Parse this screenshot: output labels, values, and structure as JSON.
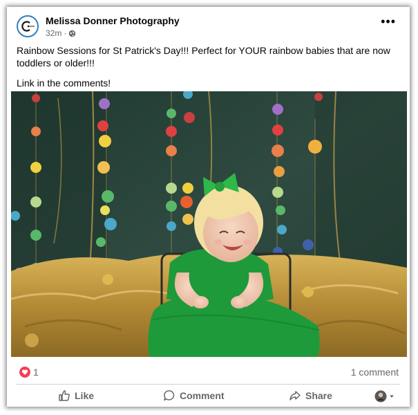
{
  "post": {
    "author": "Melissa Donner Photography",
    "timestamp": "32m",
    "privacy_icon": "globe-icon",
    "more_icon": "ellipsis-icon",
    "text_line1": "Rainbow Sessions for St Patrick's Day!!! Perfect for YOUR rainbow babies that are now toddlers or older!!!",
    "text_line2": "Link in the comments!",
    "photo_description_icon": "photo"
  },
  "reactions": {
    "icon": "heart-icon",
    "count": "1",
    "comments": "1 comment"
  },
  "actions": {
    "like": "Like",
    "comment": "Comment",
    "share": "Share"
  },
  "colors": {
    "accent": "#1877f2",
    "love": "#f33e58",
    "text_secondary": "#65676b",
    "backdrop": "#2f4a40",
    "dress": "#1e9a3a",
    "gold": "#c9a24a"
  }
}
